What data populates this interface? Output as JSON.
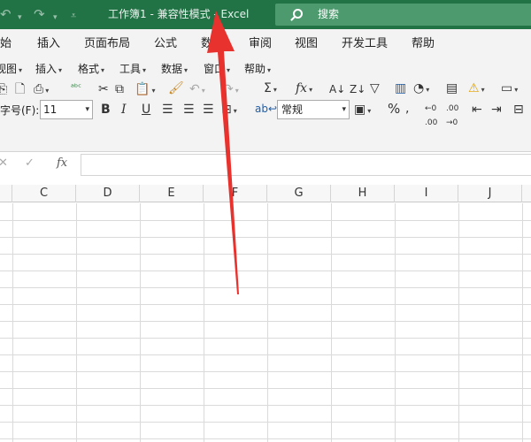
{
  "titlebar": {
    "title": "工作簿1  -  兼容性模式  -  Excel",
    "search_label": "搜索"
  },
  "tabs": [
    "开始",
    "插入",
    "页面布局",
    "公式",
    "数据",
    "审阅",
    "视图",
    "开发工具",
    "帮助"
  ],
  "classic_menu": [
    "视图",
    "插入",
    "格式",
    "工具",
    "数据",
    "窗口",
    "帮助"
  ],
  "format": {
    "font_size_label": "字号(F):",
    "font_size": "11",
    "bold": "B",
    "italic": "I",
    "underline": "U",
    "number_format": "常规",
    "percent": "%"
  },
  "formula_bar": {
    "cancel": "✕",
    "enter": "✓",
    "fx": "fx",
    "value": ""
  },
  "columns": [
    "C",
    "D",
    "E",
    "F",
    "G",
    "H",
    "I",
    "J"
  ],
  "colors": {
    "accent": "#217346",
    "annotation_arrow": "#e8322e"
  }
}
